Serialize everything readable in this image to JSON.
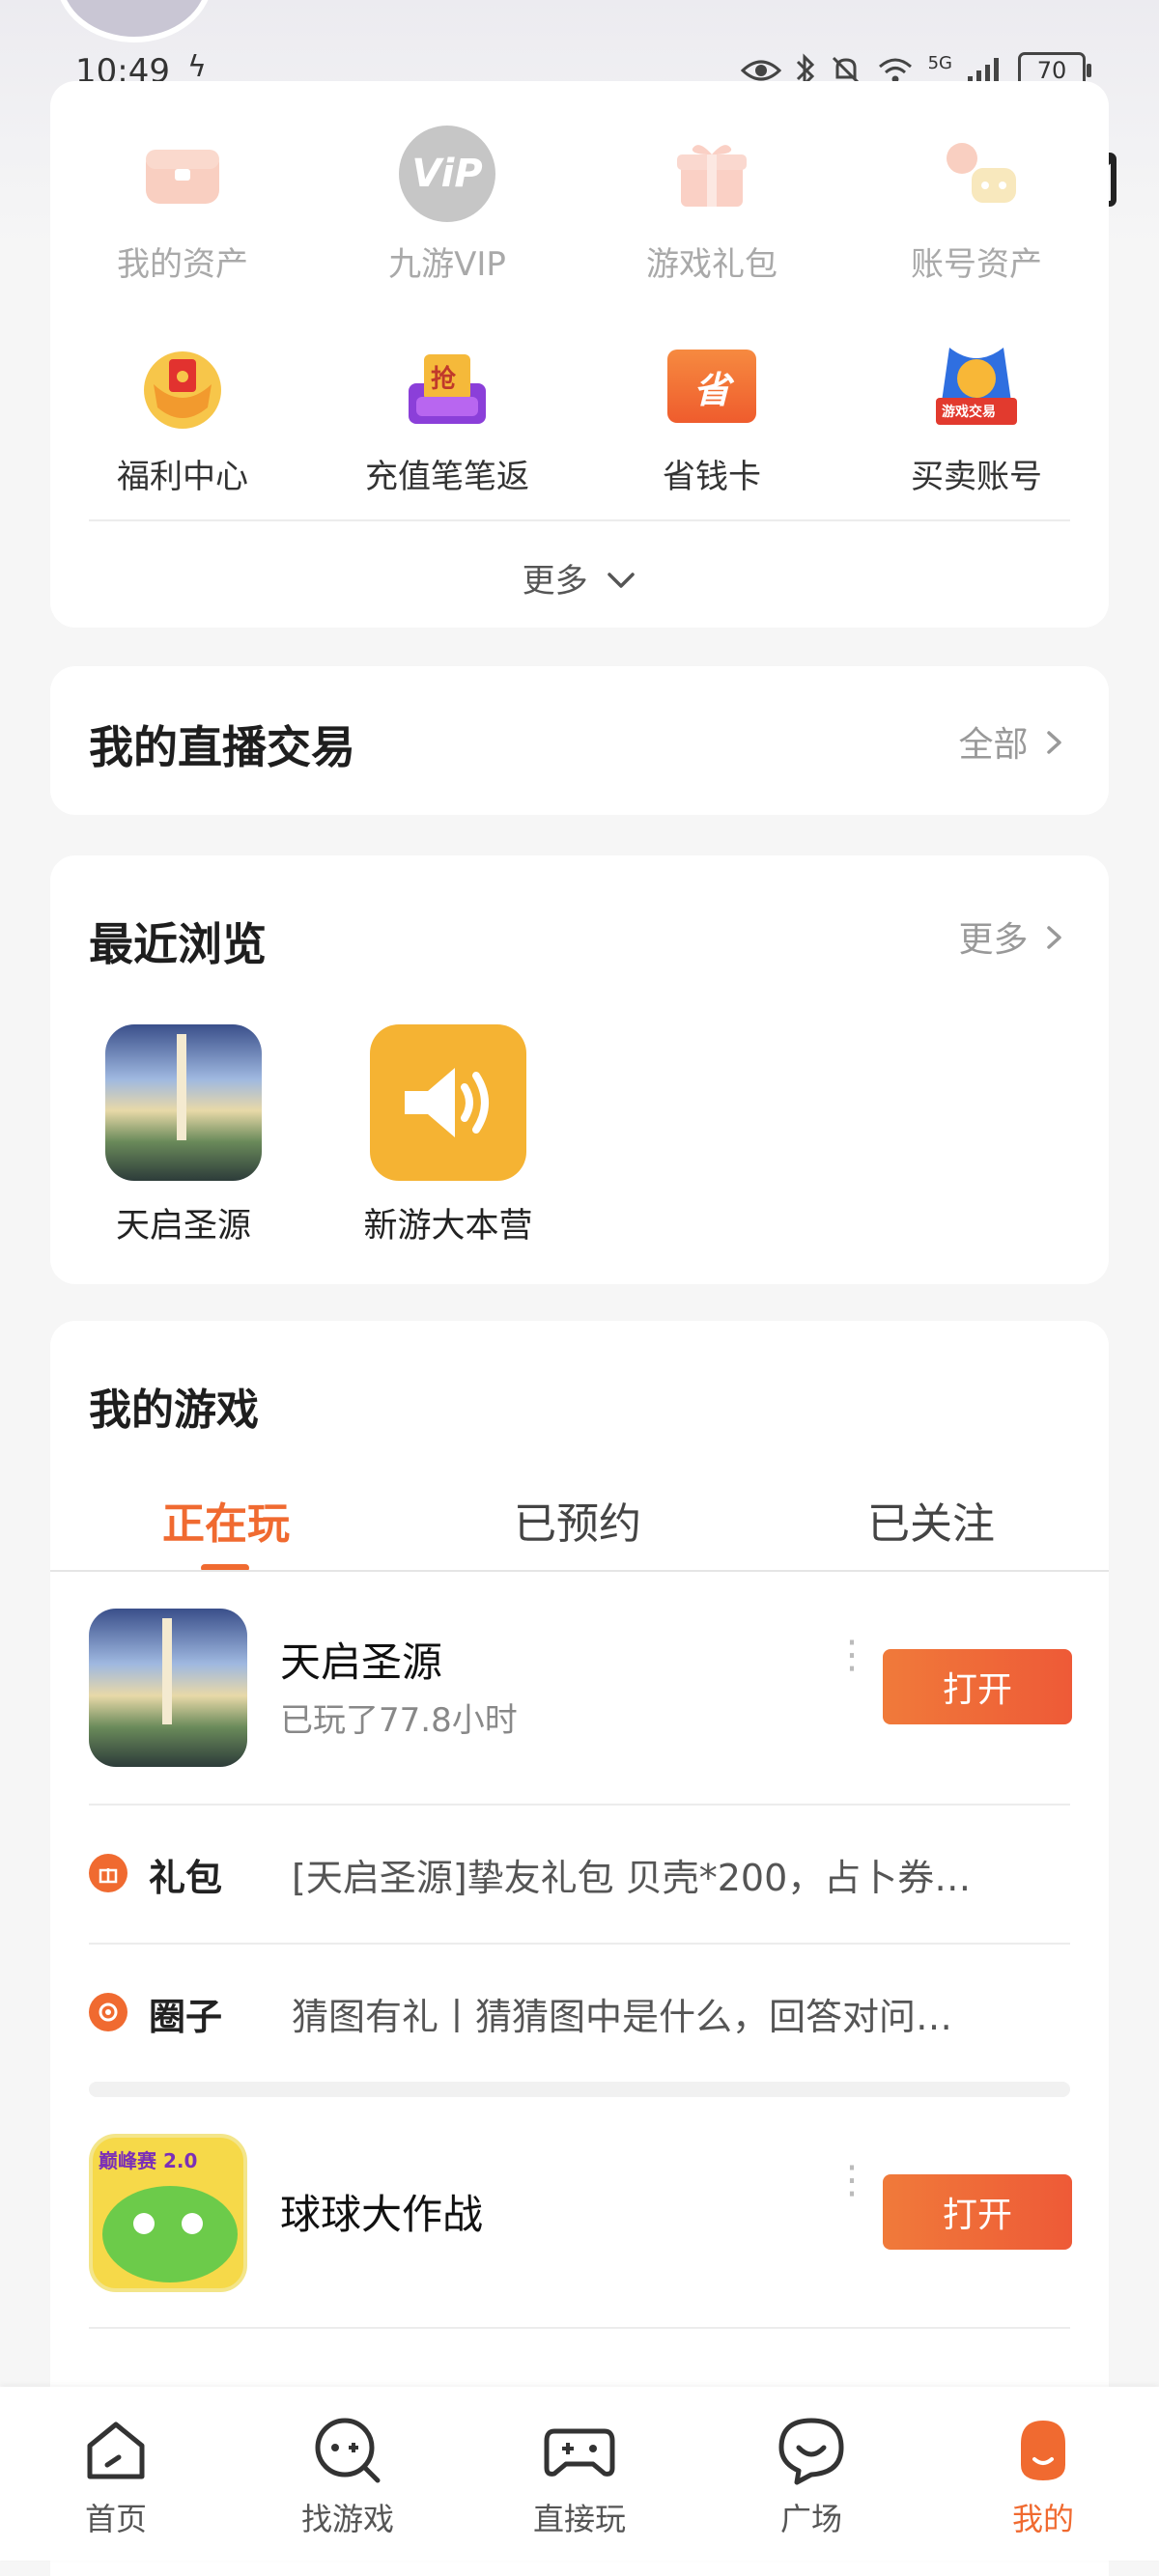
{
  "status_bar": {
    "time": "10:49",
    "battery": "70",
    "network": "5G"
  },
  "top_actions": [
    "settings",
    "download",
    "messages"
  ],
  "assets": {
    "row1": [
      {
        "label": "我的资产",
        "icon": "wallet-icon"
      },
      {
        "label": "九游VIP",
        "icon": "vip-icon",
        "badge": "ViP"
      },
      {
        "label": "游戏礼包",
        "icon": "gift-icon"
      },
      {
        "label": "账号资产",
        "icon": "account-assets-icon"
      }
    ],
    "row2": [
      {
        "label": "福利中心",
        "icon": "welfare-icon"
      },
      {
        "label": "充值笔笔返",
        "icon": "recharge-icon",
        "badge": "抢"
      },
      {
        "label": "省钱卡",
        "icon": "save-card-icon",
        "badge": "省"
      },
      {
        "label": "买卖账号",
        "icon": "trade-account-icon",
        "badge": "游戏交易"
      }
    ],
    "more_label": "更多"
  },
  "live_trade": {
    "title": "我的直播交易",
    "link": "全部"
  },
  "recent": {
    "title": "最近浏览",
    "link": "更多",
    "items": [
      {
        "label": "天启圣源"
      },
      {
        "label": "新游大本营"
      }
    ]
  },
  "my_games": {
    "title": "我的游戏",
    "tabs": [
      "正在玩",
      "已预约",
      "已关注"
    ],
    "games": [
      {
        "name": "天启圣源",
        "subtitle": "已玩了77.8小时",
        "button": "打开",
        "info": [
          {
            "title": "礼包",
            "text": "[天启圣源]挚友礼包 贝壳*200，占卜券…"
          },
          {
            "title": "圈子",
            "text": "猜图有礼丨猜猜图中是什么，回答对问…"
          }
        ]
      },
      {
        "name": "球球大作战",
        "subtitle": "",
        "badge": "巅峰赛 2.0",
        "button": "打开"
      }
    ]
  },
  "bottom_nav": [
    {
      "label": "首页"
    },
    {
      "label": "找游戏"
    },
    {
      "label": "直接玩"
    },
    {
      "label": "广场"
    },
    {
      "label": "我的"
    }
  ],
  "colors": {
    "accent": "#f06a30",
    "button_gradient_start": "#f07a3a",
    "button_gradient_end": "#ee5a37"
  }
}
